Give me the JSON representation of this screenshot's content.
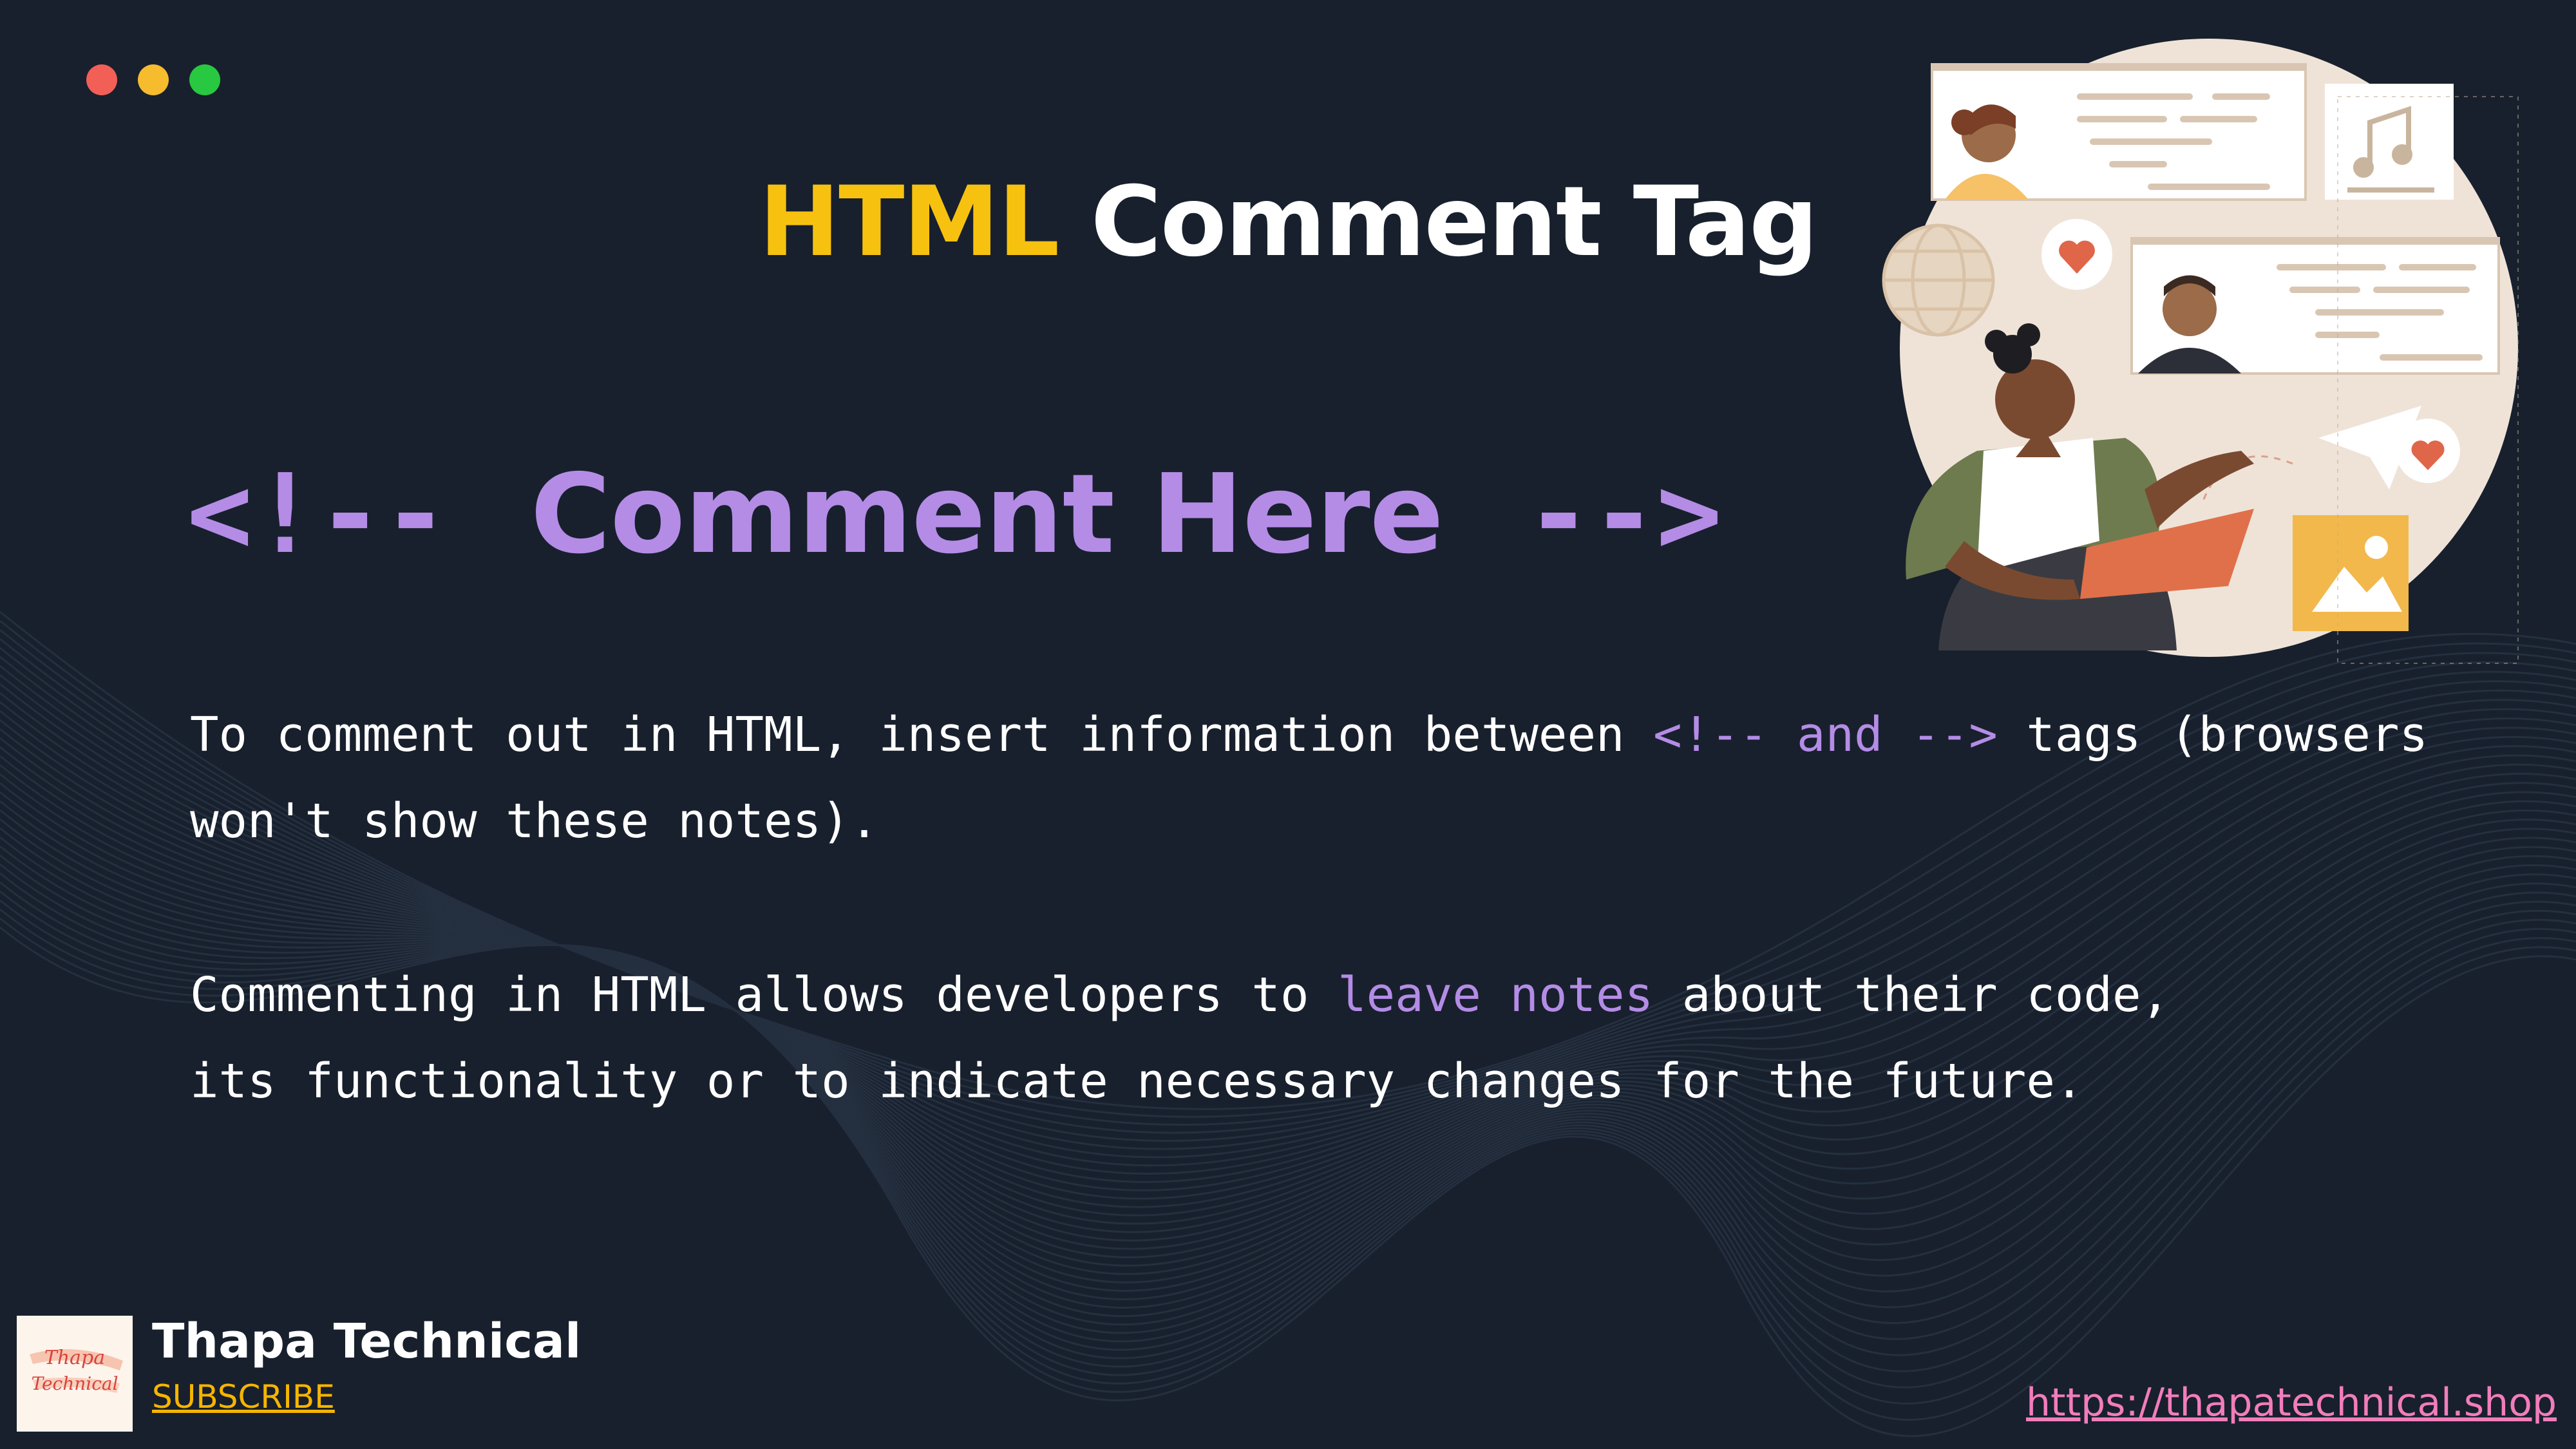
{
  "window_controls": {
    "colors": [
      "#f25f57",
      "#f7bb2e",
      "#28c840"
    ]
  },
  "title": {
    "part1": "HTML",
    "part2": "Comment Tag",
    "accent_color": "#f7c20f"
  },
  "comment_example": {
    "open": "<!--",
    "text": "Comment Here",
    "close": "-->",
    "color": "#b48ce6"
  },
  "paragraph1": {
    "line1_a": "To comment out in HTML, insert information between ",
    "line1_hl": "<!-- and -->",
    "line1_b": " tags (browsers",
    "line2": "won't show these notes)."
  },
  "paragraph2": {
    "line1_a": "Commenting in HTML allows developers to ",
    "line1_hl": "leave notes",
    "line1_b": " about their code,",
    "line2": "its functionality or to indicate necessary changes for the future."
  },
  "footer": {
    "logo_text_1": "Thapa",
    "logo_text_2": "Technical",
    "brand": "Thapa Technical",
    "subscribe": "SUBSCRIBE",
    "url": "https://thapatechnical.shop"
  },
  "icons": [
    "person-woman-icon",
    "person-man-icon",
    "person-laptop-icon",
    "heart-icon",
    "music-note-icon",
    "globe-icon",
    "paper-plane-icon",
    "image-icon"
  ]
}
